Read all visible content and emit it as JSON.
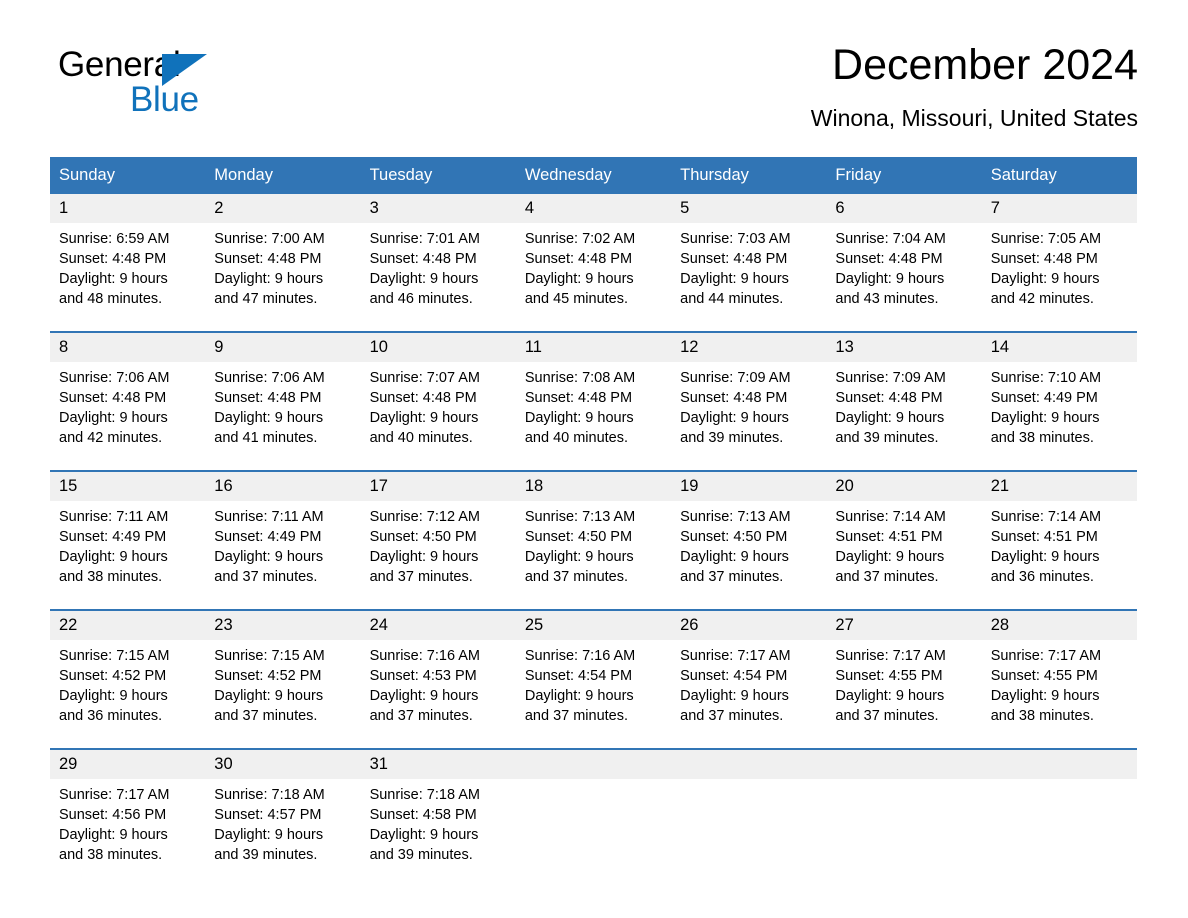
{
  "brand": {
    "word1": "General",
    "word2": "Blue",
    "triangle_color": "#1072bb",
    "logo_name": "general-blue-logo"
  },
  "header": {
    "title": "December 2024",
    "subtitle": "Winona, Missouri, United States"
  },
  "theme": {
    "header_blue": "#3175b5",
    "daynum_band": "#f0f0f0",
    "brand_blue": "#1072bb",
    "text": "#000000"
  },
  "weekdays": [
    "Sunday",
    "Monday",
    "Tuesday",
    "Wednesday",
    "Thursday",
    "Friday",
    "Saturday"
  ],
  "weeks": [
    {
      "days": [
        {
          "num": "1",
          "sunrise": "Sunrise: 6:59 AM",
          "sunset": "Sunset: 4:48 PM",
          "daylight1": "Daylight: 9 hours",
          "daylight2": "and 48 minutes."
        },
        {
          "num": "2",
          "sunrise": "Sunrise: 7:00 AM",
          "sunset": "Sunset: 4:48 PM",
          "daylight1": "Daylight: 9 hours",
          "daylight2": "and 47 minutes."
        },
        {
          "num": "3",
          "sunrise": "Sunrise: 7:01 AM",
          "sunset": "Sunset: 4:48 PM",
          "daylight1": "Daylight: 9 hours",
          "daylight2": "and 46 minutes."
        },
        {
          "num": "4",
          "sunrise": "Sunrise: 7:02 AM",
          "sunset": "Sunset: 4:48 PM",
          "daylight1": "Daylight: 9 hours",
          "daylight2": "and 45 minutes."
        },
        {
          "num": "5",
          "sunrise": "Sunrise: 7:03 AM",
          "sunset": "Sunset: 4:48 PM",
          "daylight1": "Daylight: 9 hours",
          "daylight2": "and 44 minutes."
        },
        {
          "num": "6",
          "sunrise": "Sunrise: 7:04 AM",
          "sunset": "Sunset: 4:48 PM",
          "daylight1": "Daylight: 9 hours",
          "daylight2": "and 43 minutes."
        },
        {
          "num": "7",
          "sunrise": "Sunrise: 7:05 AM",
          "sunset": "Sunset: 4:48 PM",
          "daylight1": "Daylight: 9 hours",
          "daylight2": "and 42 minutes."
        }
      ]
    },
    {
      "days": [
        {
          "num": "8",
          "sunrise": "Sunrise: 7:06 AM",
          "sunset": "Sunset: 4:48 PM",
          "daylight1": "Daylight: 9 hours",
          "daylight2": "and 42 minutes."
        },
        {
          "num": "9",
          "sunrise": "Sunrise: 7:06 AM",
          "sunset": "Sunset: 4:48 PM",
          "daylight1": "Daylight: 9 hours",
          "daylight2": "and 41 minutes."
        },
        {
          "num": "10",
          "sunrise": "Sunrise: 7:07 AM",
          "sunset": "Sunset: 4:48 PM",
          "daylight1": "Daylight: 9 hours",
          "daylight2": "and 40 minutes."
        },
        {
          "num": "11",
          "sunrise": "Sunrise: 7:08 AM",
          "sunset": "Sunset: 4:48 PM",
          "daylight1": "Daylight: 9 hours",
          "daylight2": "and 40 minutes."
        },
        {
          "num": "12",
          "sunrise": "Sunrise: 7:09 AM",
          "sunset": "Sunset: 4:48 PM",
          "daylight1": "Daylight: 9 hours",
          "daylight2": "and 39 minutes."
        },
        {
          "num": "13",
          "sunrise": "Sunrise: 7:09 AM",
          "sunset": "Sunset: 4:48 PM",
          "daylight1": "Daylight: 9 hours",
          "daylight2": "and 39 minutes."
        },
        {
          "num": "14",
          "sunrise": "Sunrise: 7:10 AM",
          "sunset": "Sunset: 4:49 PM",
          "daylight1": "Daylight: 9 hours",
          "daylight2": "and 38 minutes."
        }
      ]
    },
    {
      "days": [
        {
          "num": "15",
          "sunrise": "Sunrise: 7:11 AM",
          "sunset": "Sunset: 4:49 PM",
          "daylight1": "Daylight: 9 hours",
          "daylight2": "and 38 minutes."
        },
        {
          "num": "16",
          "sunrise": "Sunrise: 7:11 AM",
          "sunset": "Sunset: 4:49 PM",
          "daylight1": "Daylight: 9 hours",
          "daylight2": "and 37 minutes."
        },
        {
          "num": "17",
          "sunrise": "Sunrise: 7:12 AM",
          "sunset": "Sunset: 4:50 PM",
          "daylight1": "Daylight: 9 hours",
          "daylight2": "and 37 minutes."
        },
        {
          "num": "18",
          "sunrise": "Sunrise: 7:13 AM",
          "sunset": "Sunset: 4:50 PM",
          "daylight1": "Daylight: 9 hours",
          "daylight2": "and 37 minutes."
        },
        {
          "num": "19",
          "sunrise": "Sunrise: 7:13 AM",
          "sunset": "Sunset: 4:50 PM",
          "daylight1": "Daylight: 9 hours",
          "daylight2": "and 37 minutes."
        },
        {
          "num": "20",
          "sunrise": "Sunrise: 7:14 AM",
          "sunset": "Sunset: 4:51 PM",
          "daylight1": "Daylight: 9 hours",
          "daylight2": "and 37 minutes."
        },
        {
          "num": "21",
          "sunrise": "Sunrise: 7:14 AM",
          "sunset": "Sunset: 4:51 PM",
          "daylight1": "Daylight: 9 hours",
          "daylight2": "and 36 minutes."
        }
      ]
    },
    {
      "days": [
        {
          "num": "22",
          "sunrise": "Sunrise: 7:15 AM",
          "sunset": "Sunset: 4:52 PM",
          "daylight1": "Daylight: 9 hours",
          "daylight2": "and 36 minutes."
        },
        {
          "num": "23",
          "sunrise": "Sunrise: 7:15 AM",
          "sunset": "Sunset: 4:52 PM",
          "daylight1": "Daylight: 9 hours",
          "daylight2": "and 37 minutes."
        },
        {
          "num": "24",
          "sunrise": "Sunrise: 7:16 AM",
          "sunset": "Sunset: 4:53 PM",
          "daylight1": "Daylight: 9 hours",
          "daylight2": "and 37 minutes."
        },
        {
          "num": "25",
          "sunrise": "Sunrise: 7:16 AM",
          "sunset": "Sunset: 4:54 PM",
          "daylight1": "Daylight: 9 hours",
          "daylight2": "and 37 minutes."
        },
        {
          "num": "26",
          "sunrise": "Sunrise: 7:17 AM",
          "sunset": "Sunset: 4:54 PM",
          "daylight1": "Daylight: 9 hours",
          "daylight2": "and 37 minutes."
        },
        {
          "num": "27",
          "sunrise": "Sunrise: 7:17 AM",
          "sunset": "Sunset: 4:55 PM",
          "daylight1": "Daylight: 9 hours",
          "daylight2": "and 37 minutes."
        },
        {
          "num": "28",
          "sunrise": "Sunrise: 7:17 AM",
          "sunset": "Sunset: 4:55 PM",
          "daylight1": "Daylight: 9 hours",
          "daylight2": "and 38 minutes."
        }
      ]
    },
    {
      "days": [
        {
          "num": "29",
          "sunrise": "Sunrise: 7:17 AM",
          "sunset": "Sunset: 4:56 PM",
          "daylight1": "Daylight: 9 hours",
          "daylight2": "and 38 minutes."
        },
        {
          "num": "30",
          "sunrise": "Sunrise: 7:18 AM",
          "sunset": "Sunset: 4:57 PM",
          "daylight1": "Daylight: 9 hours",
          "daylight2": "and 39 minutes."
        },
        {
          "num": "31",
          "sunrise": "Sunrise: 7:18 AM",
          "sunset": "Sunset: 4:58 PM",
          "daylight1": "Daylight: 9 hours",
          "daylight2": "and 39 minutes."
        },
        {
          "num": "",
          "sunrise": "",
          "sunset": "",
          "daylight1": "",
          "daylight2": ""
        },
        {
          "num": "",
          "sunrise": "",
          "sunset": "",
          "daylight1": "",
          "daylight2": ""
        },
        {
          "num": "",
          "sunrise": "",
          "sunset": "",
          "daylight1": "",
          "daylight2": ""
        },
        {
          "num": "",
          "sunrise": "",
          "sunset": "",
          "daylight1": "",
          "daylight2": ""
        }
      ]
    }
  ]
}
